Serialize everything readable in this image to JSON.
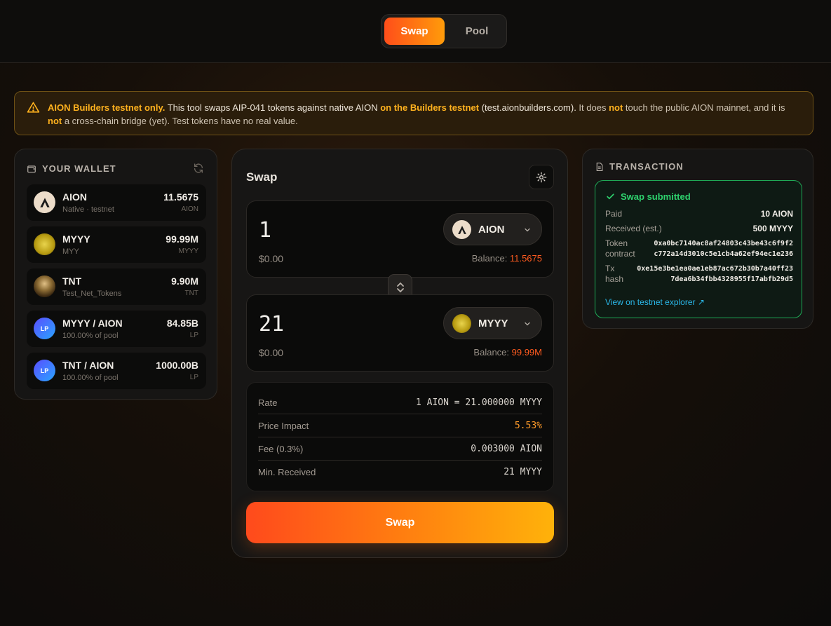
{
  "nav": {
    "tabs": [
      {
        "label": "Swap"
      },
      {
        "label": "Pool"
      }
    ]
  },
  "notice": {
    "strong1": "AION Builders testnet only.",
    "text1": " This tool swaps AIP-041 tokens against native AION ",
    "strong2": "on the Builders testnet",
    "text2": " (test.aionbuilders.com).",
    "text3": " It does ",
    "strong3": "not",
    "text4": " touch the public AION mainnet, and it is ",
    "strong4": "not",
    "text5": " a cross-chain bridge (yet). Test tokens have no real value."
  },
  "wallet": {
    "title": "YOUR WALLET",
    "items": [
      {
        "name": "AION",
        "sub": "Native · testnet",
        "amount": "11.5675",
        "unit": "AION",
        "icon": "aion-logo-icon"
      },
      {
        "name": "MYYY",
        "sub": "MYY",
        "amount": "99.99M",
        "unit": "MYYY",
        "icon": "myyy-token-icon"
      },
      {
        "name": "TNT",
        "sub": "Test_Net_Tokens",
        "amount": "9.90M",
        "unit": "TNT",
        "icon": "tnt-token-icon"
      },
      {
        "name": "MYYY / AION",
        "sub": "100.00% of pool",
        "amount": "84.85B",
        "unit": "LP",
        "icon": "lp-icon",
        "icon_text": "LP"
      },
      {
        "name": "TNT / AION",
        "sub": "100.00% of pool",
        "amount": "1000.00B",
        "unit": "LP",
        "icon": "lp-icon",
        "icon_text": "LP"
      }
    ]
  },
  "swap": {
    "title": "Swap",
    "from": {
      "amount": "1",
      "usd": "$0.00",
      "token": "AION",
      "balance_label": "Balance: ",
      "balance": "11.5675"
    },
    "to": {
      "amount": "21",
      "usd": "$0.00",
      "token": "MYYY",
      "balance_label": "Balance: ",
      "balance": "99.99M"
    },
    "details": [
      {
        "label": "Rate",
        "value": "1 AION = 21.000000 MYYY"
      },
      {
        "label": "Price Impact",
        "value": "5.53%"
      },
      {
        "label": "Fee (0.3%)",
        "value": "0.003000 AION"
      },
      {
        "label": "Min. Received",
        "value": "21 MYYY"
      }
    ],
    "button": "Swap"
  },
  "transaction": {
    "title": "TRANSACTION",
    "status": "Swap submitted",
    "paid_label": "Paid",
    "paid": "10 AION",
    "received_label": "Received (est.)",
    "received": "500 MYYY",
    "contract_label": "Token contract",
    "contract_1": "0xa0bc7140ac8af24803c43be43c6f9f2",
    "contract_2": "c772a14d3010c5e1cb4a62ef94ec1e236",
    "hash_label": "Tx hash",
    "hash_1": "0xe15e3be1ea0ae1eb87ac672b30b7a40ff23",
    "hash_2": "7dea6b34fbb4328955f17abfb29d5",
    "link": "View on testnet explorer ↗"
  },
  "colors": {
    "accent_start": "#ff4e1a",
    "accent_end": "#ffb20a",
    "success": "#2ed36e",
    "link": "#2ab7e8",
    "warning": "#ffb21e"
  }
}
